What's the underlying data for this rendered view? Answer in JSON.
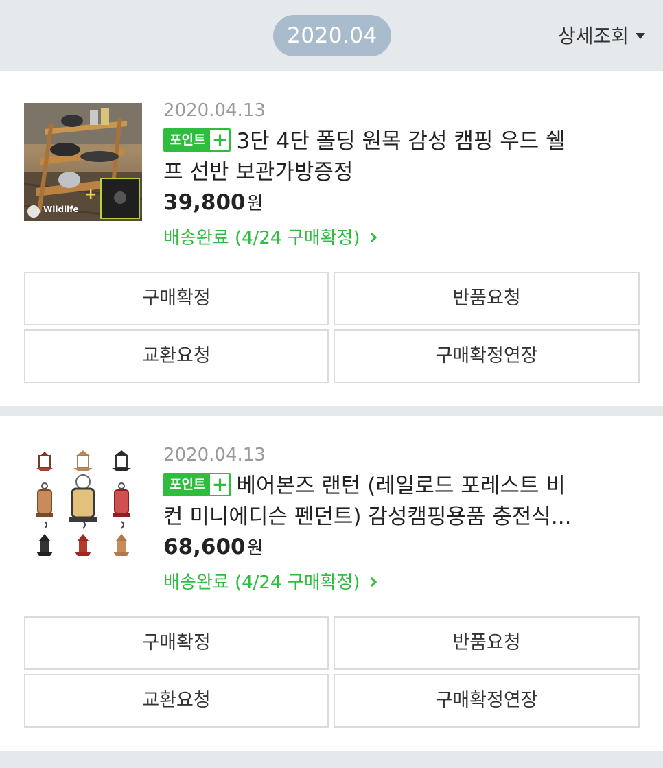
{
  "header": {
    "month": "2020.04",
    "detail_label": "상세조회",
    "detail_icon": "caret-down-icon"
  },
  "orders": [
    {
      "date": "2020.04.13",
      "badge_label": "포인트",
      "badge_plus": "+",
      "title_line1": "3단 4단 폴딩 원목 감성 캠핑 우드 쉘",
      "title_line2": "프 선반 보관가방증정",
      "price": "39,800",
      "currency": "원",
      "status": "배송완료 (4/24 구매확정)",
      "thumb_brand": "Wildlife",
      "buttons": [
        "구매확정",
        "반품요청",
        "교환요청",
        "구매확정연장"
      ]
    },
    {
      "date": "2020.04.13",
      "badge_label": "포인트",
      "badge_plus": "+",
      "title_line1": "베어본즈 랜턴 (레일로드 포레스트 비",
      "title_line2": "컨 미니에디슨 펜던트) 감성캠핑용품 충전식...",
      "price": "68,600",
      "currency": "원",
      "status": "배송완료 (4/24 구매확정)",
      "buttons": [
        "구매확정",
        "반품요청",
        "교환요청",
        "구매확정연장"
      ]
    }
  ],
  "colors": {
    "accent_green": "#2ebd3f",
    "pill_blue": "#a9bccd",
    "background": "#e6e9ec"
  }
}
